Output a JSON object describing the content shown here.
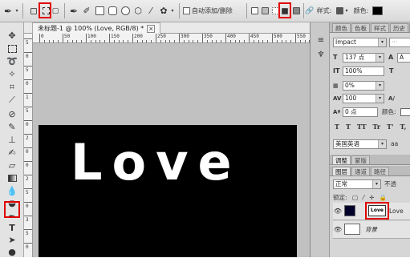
{
  "options_bar": {
    "auto_add_delete_label": "自动添加/删除",
    "style_label": "样式:",
    "color_label": "颜色:",
    "highlight_color": "#e00000"
  },
  "toolbox": {
    "icons": [
      "move-icon",
      "marquee-icon",
      "lasso-icon",
      "magic-wand-icon",
      "crop-icon",
      "eyedropper-icon",
      "healing-brush-icon",
      "brush-icon",
      "clone-stamp-icon",
      "history-brush-icon",
      "eraser-icon",
      "gradient-icon",
      "blur-icon",
      "dodge-icon",
      "pen-icon",
      "type-icon",
      "path-select-icon",
      "shape-icon",
      "hand-icon",
      "zoom-icon"
    ]
  },
  "document": {
    "tab_title": "未标题-1 @ 100% (Love, RGB/8) *",
    "ruler_top": [
      "0",
      "50",
      "100",
      "150",
      "200",
      "250",
      "300",
      "350",
      "400",
      "450",
      "500",
      "550"
    ],
    "ruler_left": [
      "5",
      "0",
      "5",
      "0",
      "1",
      "5",
      "0",
      "2",
      "0",
      "0",
      "2",
      "5",
      "0",
      "3",
      "5",
      "0"
    ],
    "canvas_text": "Love"
  },
  "panels": {
    "top_tabs": [
      "颜色",
      "色板",
      "样式",
      "历史",
      "字"
    ],
    "character": {
      "font_family": "Impact",
      "font_size": "137 点",
      "leading_prefix": "A",
      "vertical_scale": "100%",
      "tracking": "0%",
      "kerning": "100",
      "baseline_shift": "0 点",
      "color_label": "颜色:",
      "type_buttons": [
        "T",
        "T",
        "TT",
        "Tr",
        "T'",
        "T,"
      ],
      "language": "美国英语",
      "anti_alias": "aa"
    },
    "adjust_tabs": [
      "调整",
      "蒙版"
    ],
    "layer_tabs": [
      "图层",
      "通道",
      "路径"
    ],
    "blend_mode": "正常",
    "opacity_label": "不透",
    "lock_label": "锁定:",
    "layers": [
      {
        "name": "Love",
        "thumb_text": "Love"
      },
      {
        "name": "背景"
      }
    ]
  }
}
